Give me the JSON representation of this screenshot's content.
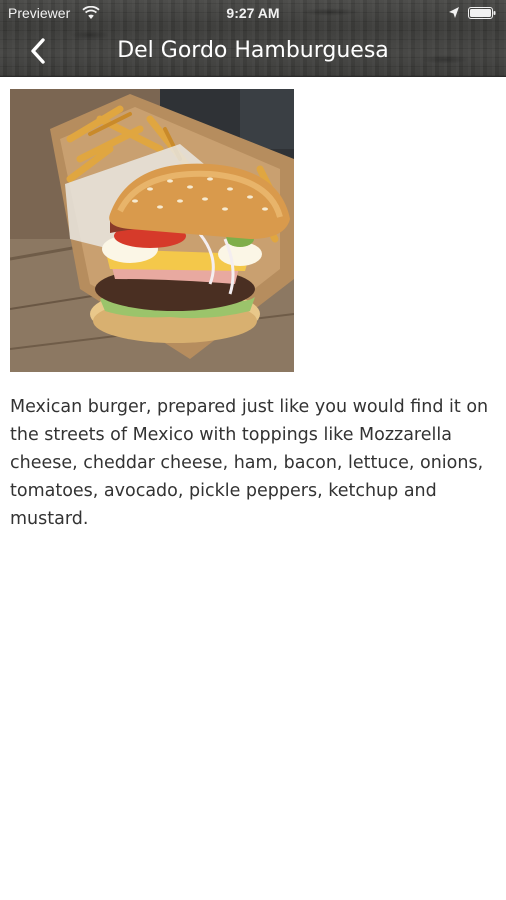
{
  "status_bar": {
    "carrier": "Previewer",
    "time": "9:27 AM",
    "wifi_icon": "wifi-icon",
    "location_icon": "location-arrow-icon",
    "battery_icon": "battery-icon"
  },
  "nav": {
    "title": "Del Gordo Hamburguesa",
    "back_icon": "chevron-left-icon"
  },
  "item": {
    "image_subject": "burger with fries",
    "description": "Mexican burger, prepared just like you would find it on the streets of Mexico with toppings like Mozzarella cheese, cheddar cheese, ham, bacon, lettuce, onions, tomatoes, avocado, pickle peppers, ketchup and mustard."
  },
  "colors": {
    "bar_background": "#3f3f3d",
    "bar_text": "#ffffff",
    "body_text": "#333333",
    "page_background": "#ffffff"
  }
}
